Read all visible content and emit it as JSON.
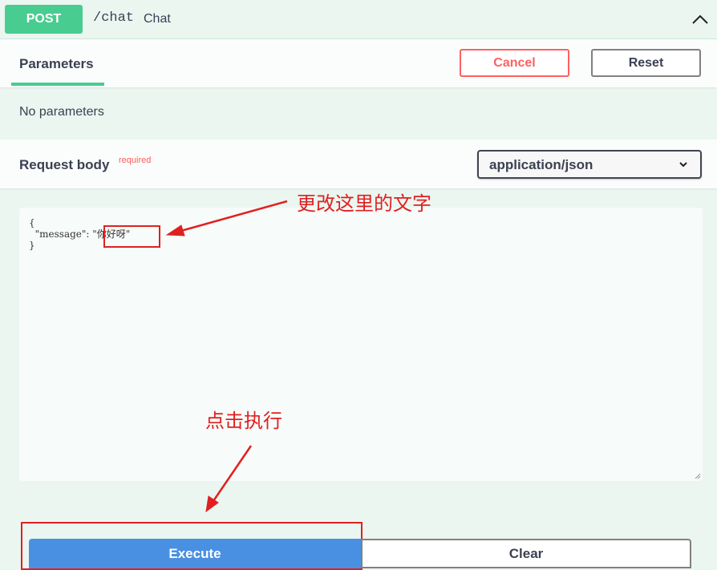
{
  "operation": {
    "method": "POST",
    "path": "/chat",
    "summary": "Chat"
  },
  "parameters": {
    "tab_label": "Parameters",
    "cancel_label": "Cancel",
    "reset_label": "Reset",
    "empty_text": "No parameters"
  },
  "request_body": {
    "label": "Request body",
    "required_label": "required",
    "content_type": "application/json"
  },
  "editor": {
    "line1": "{",
    "key": "\"message\"",
    "colon": ": ",
    "value": "\"你好呀\"",
    "line3": "}"
  },
  "annotations": {
    "edit_hint": "更改这里的文字",
    "execute_hint": "点击执行"
  },
  "actions": {
    "execute_label": "Execute",
    "clear_label": "Clear"
  },
  "colors": {
    "method_post": "#49cc90",
    "cancel": "#ff6060",
    "execute": "#4990e2",
    "annotation": "#e02020"
  },
  "icons": {
    "collapse": "chevron-up-icon",
    "select": "chevron-down-icon"
  }
}
